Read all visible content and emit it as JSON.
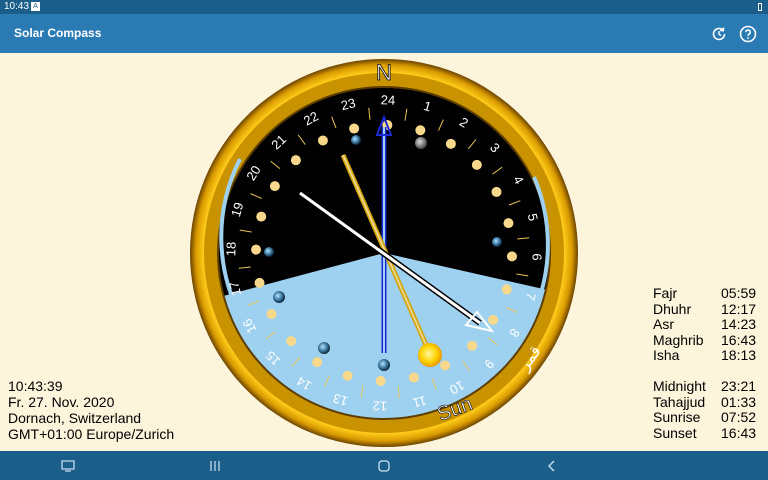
{
  "status_bar": {
    "time": "10:43"
  },
  "app_bar": {
    "title": "Solar Compass"
  },
  "info": {
    "time": "10:43:39",
    "date": "Fr. 27. Nov. 2020",
    "location": "Dornach, Switzerland",
    "timezone": "GMT+01:00 Europe/Zurich"
  },
  "prayers": [
    {
      "name": "Fajr",
      "time": "05:59"
    },
    {
      "name": "Dhuhr",
      "time": "12:17"
    },
    {
      "name": "Asr",
      "time": "14:23"
    },
    {
      "name": "Maghrib",
      "time": "16:43"
    },
    {
      "name": "Isha",
      "time": "18:13"
    }
  ],
  "events": [
    {
      "name": "Midnight",
      "time": "23:21"
    },
    {
      "name": "Tahajjud",
      "time": "01:33"
    },
    {
      "name": "Sunrise",
      "time": "07:52"
    },
    {
      "name": "Sunset",
      "time": "16:43"
    }
  ],
  "compass": {
    "north_label": "N",
    "sun_label": "Sun",
    "moon_label": "قمر",
    "hour_labels": [
      "24",
      "1",
      "2",
      "3",
      "4",
      "5",
      "6",
      "7",
      "8",
      "9",
      "10",
      "11",
      "12",
      "13",
      "14",
      "15",
      "16",
      "17",
      "18",
      "19",
      "20",
      "21",
      "22",
      "23"
    ],
    "colors": {
      "night": "#000000",
      "day": "#9ed0ef",
      "ring": "#d9a400",
      "dot": "#f8d98c",
      "sun": "#ffd400"
    }
  },
  "icons": {
    "notification": "notification-icon",
    "battery": "battery-icon",
    "refresh": "refresh-icon",
    "help": "help-icon",
    "recents": "recents-icon",
    "home": "home-icon",
    "back": "back-icon",
    "screenshot": "screenshot-icon"
  }
}
